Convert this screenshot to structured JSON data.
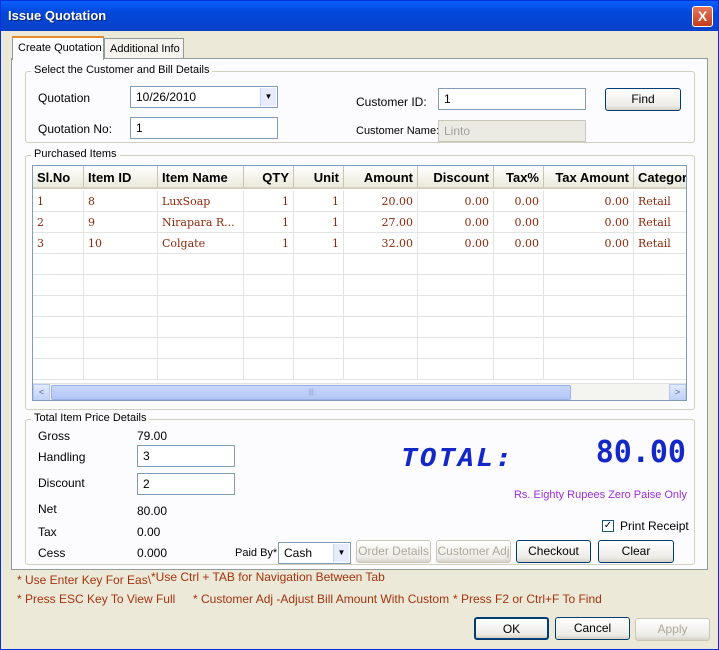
{
  "window": {
    "title": "Issue Quotation",
    "close": "X"
  },
  "tabs": [
    {
      "label": "Create Quotation"
    },
    {
      "label": "Additional Info"
    }
  ],
  "customer_group": {
    "title": "Select the Customer and Bill Details",
    "quotation_label": "Quotation",
    "quotation_date": "10/26/2010",
    "quotation_no_label": "Quotation No:",
    "quotation_no": "1",
    "customer_id_label": "Customer ID:",
    "customer_id": "1",
    "find_label": "Find",
    "customer_name_label": "Customer Name:",
    "customer_name": "Linto"
  },
  "items_group": {
    "title": "Purchased Items",
    "columns": [
      "Sl.No",
      "Item ID",
      "Item Name",
      "QTY",
      "Unit",
      "Amount",
      "Discount",
      "Tax%",
      "Tax Amount",
      "Categor"
    ],
    "rows": [
      [
        "1",
        "8",
        "LuxSoap",
        "1",
        "1",
        "20.00",
        "0.00",
        "0.00",
        "0.00",
        "Retail"
      ],
      [
        "2",
        "9",
        "Nirapara R...",
        "1",
        "1",
        "27.00",
        "0.00",
        "0.00",
        "0.00",
        "Retail"
      ],
      [
        "3",
        "10",
        "Colgate",
        "1",
        "1",
        "32.00",
        "0.00",
        "0.00",
        "0.00",
        "Retail"
      ]
    ],
    "scroll_left": "<",
    "scroll_right": ">",
    "scroll_thumb": "|||"
  },
  "totals_group": {
    "title": "Total Item Price Details",
    "gross_label": "Gross",
    "gross": "79.00",
    "handling_label": "Handling",
    "handling": "3",
    "discount_label": "Discount",
    "discount": "2",
    "net_label": "Net",
    "net": "80.00",
    "tax_label": "Tax",
    "tax": "0.00",
    "cess_label": "Cess",
    "cess": "0.000",
    "total_label": "TOTAL:",
    "total": "80.00",
    "amount_words": "Rs. Eighty Rupees Zero Paise Only",
    "print_receipt_label": "Print Receipt",
    "print_receipt_checked": "✓",
    "paid_by_label": "Paid By*",
    "paid_by": "Cash",
    "order_details_label": "Order Details",
    "customer_adj_label": "Customer Adj",
    "checkout_label": "Checkout",
    "clear_label": "Clear"
  },
  "hints": {
    "enter": "* Use Enter Key For Eas\\",
    "ctrl_tab": "*Use Ctrl + TAB for Navigation Between Tab",
    "esc": "* Press ESC Key To View Full",
    "adj": "* Customer Adj -Adjust Bill Amount With Custom",
    "f2": "* Press F2 or Ctrl+F To Find"
  },
  "footer": {
    "ok": "OK",
    "cancel": "Cancel",
    "apply": "Apply"
  },
  "colors": {
    "title_bar": "#0a5fff",
    "grid_text": "#8b2a0c",
    "total": "#1428c8",
    "words": "#9b30d8",
    "hint": "#a33410"
  }
}
